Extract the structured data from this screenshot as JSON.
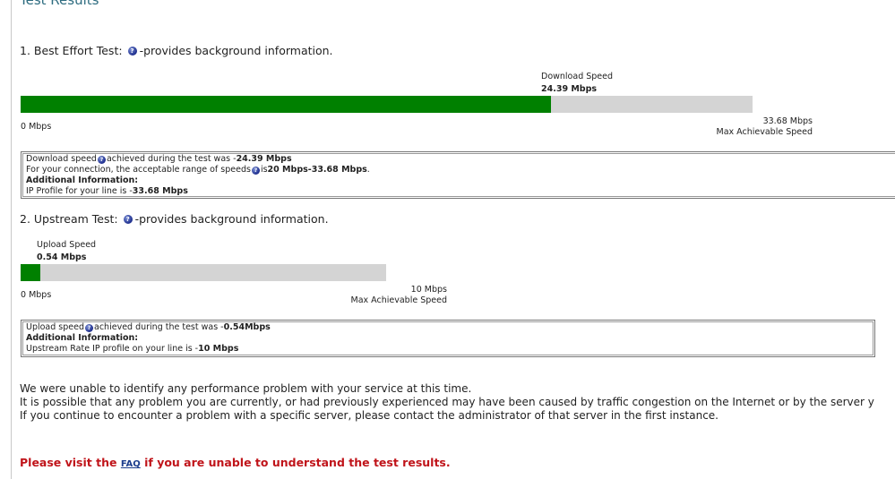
{
  "page_title": "Test Results",
  "best_effort": {
    "heading_prefix": "1. Best Effort Test:",
    "heading_suffix": "-provides background information.",
    "speed_label": "Download Speed",
    "speed_value": "24.39 Mbps",
    "bar_fraction": 0.724,
    "min_label": "0 Mbps",
    "max_value": "33.68 Mbps",
    "max_label": "Max Achievable Speed",
    "info": {
      "line1_a": "Download speed",
      "line1_b": "achieved during the test was - ",
      "line1_value": "24.39 Mbps",
      "line2_a": "For your connection, the acceptable range of speeds",
      "line2_b": "is ",
      "line2_value": "20 Mbps-33.68 Mbps",
      "line2_end": " .",
      "line3": "Additional Information:",
      "line4_a": "IP Profile for your line is - ",
      "line4_value": "33.68 Mbps"
    }
  },
  "upstream": {
    "heading_prefix": "2. Upstream Test:",
    "heading_suffix": "-provides background information.",
    "speed_label": "Upload Speed",
    "speed_value": "0.54 Mbps",
    "bar_fraction": 0.054,
    "min_label": "0 Mbps",
    "max_value": "10 Mbps",
    "max_label": "Max Achievable Speed",
    "info": {
      "line1_a": "Upload speed",
      "line1_b": " achieved during the test was - ",
      "line1_value": "0.54Mbps",
      "line2": "Additional Information:",
      "line3_a": "Upstream Rate IP profile on your line is - ",
      "line3_value": "10 Mbps"
    }
  },
  "messages": {
    "p1": "We were unable to identify any performance problem with your service at this time.",
    "p2": "It is possible that any problem you are currently, or had previously experienced may have been caused by traffic congestion on the Internet or by the server y",
    "p3": "If you continue to encounter a problem with a specific server, please contact the administrator of that server in the first instance."
  },
  "faq": {
    "prefix": "Please visit the ",
    "link": "FAQ",
    "suffix": " if you are unable to understand the test results."
  },
  "colors": {
    "bar_fill": "#008000",
    "bar_track": "#d4d4d4",
    "faq_text": "#c0141a",
    "title": "#2e6c80"
  },
  "icons": {
    "help": "question-circle-icon"
  }
}
